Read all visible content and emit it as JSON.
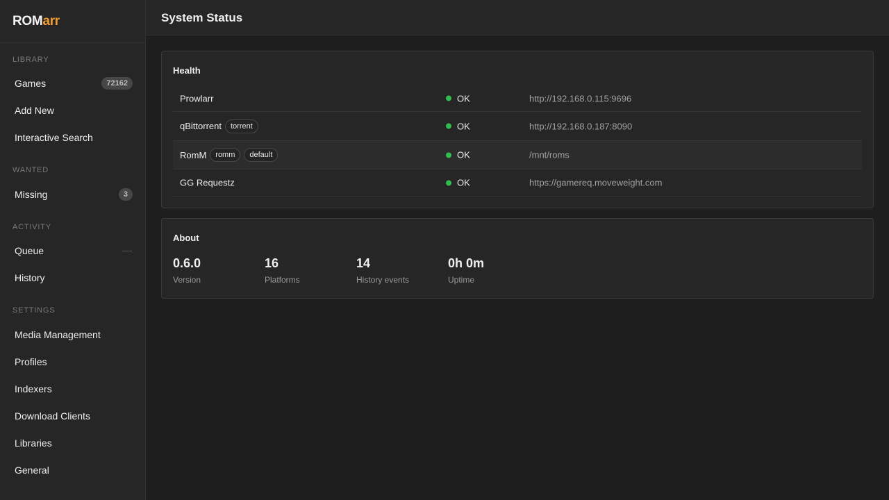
{
  "app": {
    "name_main": "ROM",
    "name_accent": "arr",
    "accent_color": "#f39c2c"
  },
  "sidebar": {
    "sections": {
      "library": "LIBRARY",
      "wanted": "WANTED",
      "activity": "ACTIVITY",
      "settings": "SETTINGS"
    },
    "items": {
      "games": {
        "label": "Games",
        "badge": "72162"
      },
      "add_new": {
        "label": "Add New"
      },
      "interactive_search": {
        "label": "Interactive Search"
      },
      "missing": {
        "label": "Missing",
        "badge": "3"
      },
      "queue": {
        "label": "Queue"
      },
      "history": {
        "label": "History"
      },
      "media_management": {
        "label": "Media Management"
      },
      "profiles": {
        "label": "Profiles"
      },
      "indexers": {
        "label": "Indexers"
      },
      "download_clients": {
        "label": "Download Clients"
      },
      "libraries": {
        "label": "Libraries"
      },
      "general": {
        "label": "General"
      }
    }
  },
  "header": {
    "title": "System Status"
  },
  "health": {
    "title": "Health",
    "status_color": "#2ebd4e",
    "rows": [
      {
        "name": "Prowlarr",
        "tags": [],
        "status": "OK",
        "url": "http://192.168.0.115:9696"
      },
      {
        "name": "qBittorrent",
        "tags": [
          "torrent"
        ],
        "status": "OK",
        "url": "http://192.168.0.187:8090"
      },
      {
        "name": "RomM",
        "tags": [
          "romm",
          "default"
        ],
        "status": "OK",
        "url": "/mnt/roms"
      },
      {
        "name": "GG Requestz",
        "tags": [],
        "status": "OK",
        "url": "https://gamereq.moveweight.com"
      }
    ]
  },
  "about": {
    "title": "About",
    "stats": [
      {
        "value": "0.6.0",
        "label": "Version"
      },
      {
        "value": "16",
        "label": "Platforms"
      },
      {
        "value": "14",
        "label": "History events"
      },
      {
        "value": "0h 0m",
        "label": "Uptime"
      }
    ]
  }
}
